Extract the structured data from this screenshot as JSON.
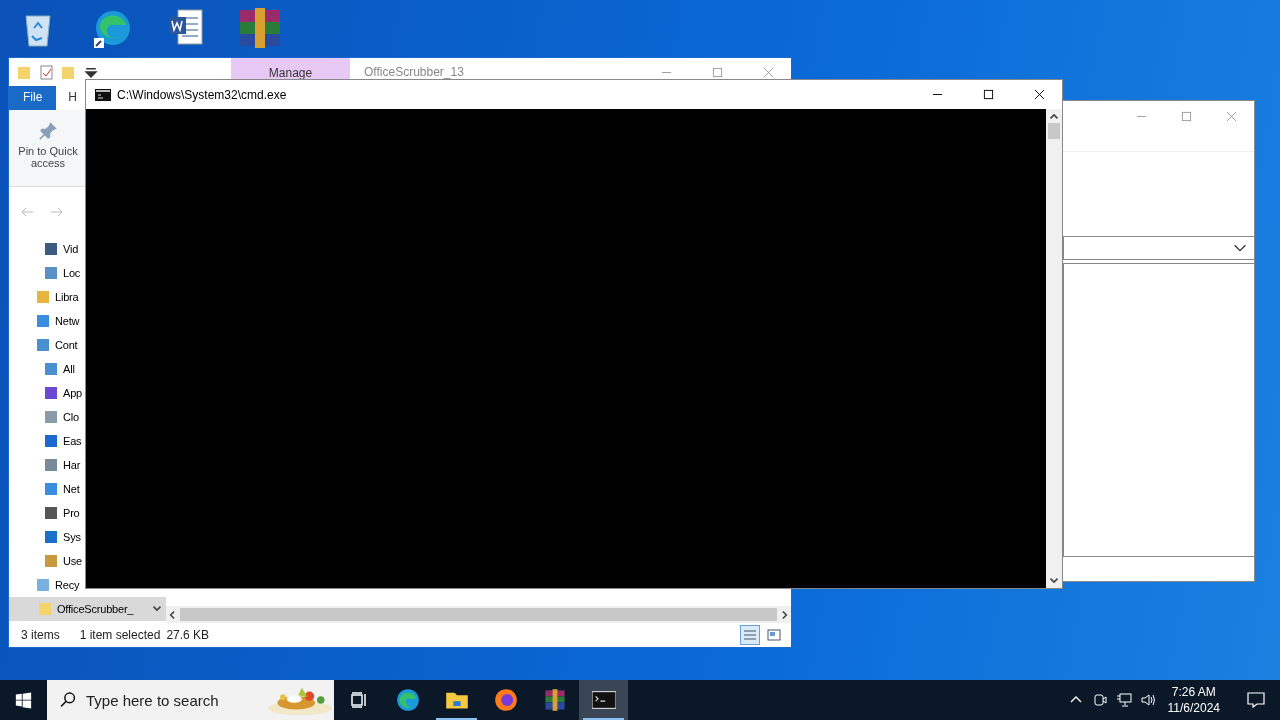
{
  "explorer": {
    "title": "OfficeScrubber_13",
    "context_tab": "Manage",
    "tabs": [
      {
        "label": "File",
        "selected": true
      },
      {
        "label": "H",
        "selected": false
      }
    ],
    "ribbon_button": "Pin to Quick access",
    "nav_orphans": [
      {
        "label": "Vid"
      },
      {
        "label": "Loc"
      }
    ],
    "nav_items": [
      {
        "label": "Libra",
        "selected": false
      },
      {
        "label": "Netw",
        "selected": false
      },
      {
        "label": "Cont",
        "selected": false,
        "children": [
          {
            "label": "All",
            "selected": false
          },
          {
            "label": "App",
            "selected": false
          },
          {
            "label": "Clo",
            "selected": false
          },
          {
            "label": "Eas",
            "selected": false
          },
          {
            "label": "Har",
            "selected": false
          },
          {
            "label": "Net",
            "selected": false
          },
          {
            "label": "Pro",
            "selected": false
          },
          {
            "label": "Sys",
            "selected": false
          },
          {
            "label": "Use",
            "selected": false
          }
        ]
      },
      {
        "label": "Recy",
        "selected": false
      },
      {
        "label": "OfficeScrubber_",
        "selected": true
      }
    ],
    "status": {
      "count": "3 items",
      "selection": "1 item selected",
      "size": "27.6 KB"
    }
  },
  "cmd": {
    "title": "C:\\Windows\\System32\\cmd.exe"
  },
  "taskbar": {
    "search_placeholder": "Type here to search",
    "apps": [
      {
        "running": false,
        "selected": false
      },
      {
        "running": false,
        "selected": false
      },
      {
        "running": true,
        "selected": false
      },
      {
        "running": false,
        "selected": false
      },
      {
        "running": false,
        "selected": false
      },
      {
        "running": true,
        "selected": true
      }
    ],
    "time": "7:26 AM",
    "date": "11/6/2024"
  }
}
